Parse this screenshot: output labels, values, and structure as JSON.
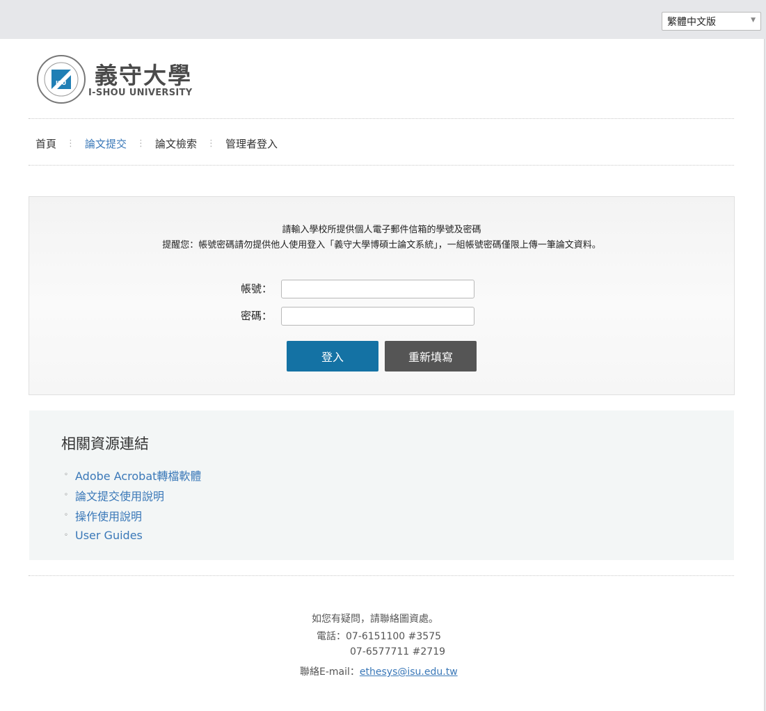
{
  "language_selector": {
    "selected": "繁體中文版"
  },
  "logo": {
    "cn": "義守大學",
    "en": "I-SHOU UNIVERSITY",
    "badge": "ISU",
    "seal_text": "義守大學 I-SHOU UNIVERSITY"
  },
  "nav": {
    "items": [
      {
        "label": "首頁"
      },
      {
        "label": "論文提交"
      },
      {
        "label": "論文檢索"
      },
      {
        "label": "管理者登入"
      }
    ],
    "separator": "⋮"
  },
  "login": {
    "message1": "請輸入學校所提供個人電子郵件信箱的學號及密碼",
    "message2": "提醒您：帳號密碼請勿提供他人使用登入「義守大學博碩士論文系統」，一組帳號密碼僅限上傳一筆論文資料。",
    "account_label": "帳號：",
    "password_label": "密碼：",
    "account_value": "",
    "password_value": "",
    "login_button": "登入",
    "reset_button": "重新填寫"
  },
  "resources": {
    "title": "相關資源連結",
    "bullet": "◦",
    "links": [
      {
        "label": "Adobe Acrobat轉檔軟體"
      },
      {
        "label": "論文提交使用說明"
      },
      {
        "label": "操作使用說明"
      },
      {
        "label": "User Guides"
      }
    ]
  },
  "footer": {
    "line1": "如您有疑問，請聯絡圖資處。",
    "phone_label": "電話：",
    "phone1": "07-6151100 #3575",
    "phone2": "07-6577711 #2719",
    "email_label": "聯絡E-mail：",
    "email": "ethesys@isu.edu.tw"
  },
  "colors": {
    "primary": "#1472a4",
    "secondary": "#555555",
    "link": "#3a78b8",
    "logo_blue": "#1f7fb5"
  }
}
